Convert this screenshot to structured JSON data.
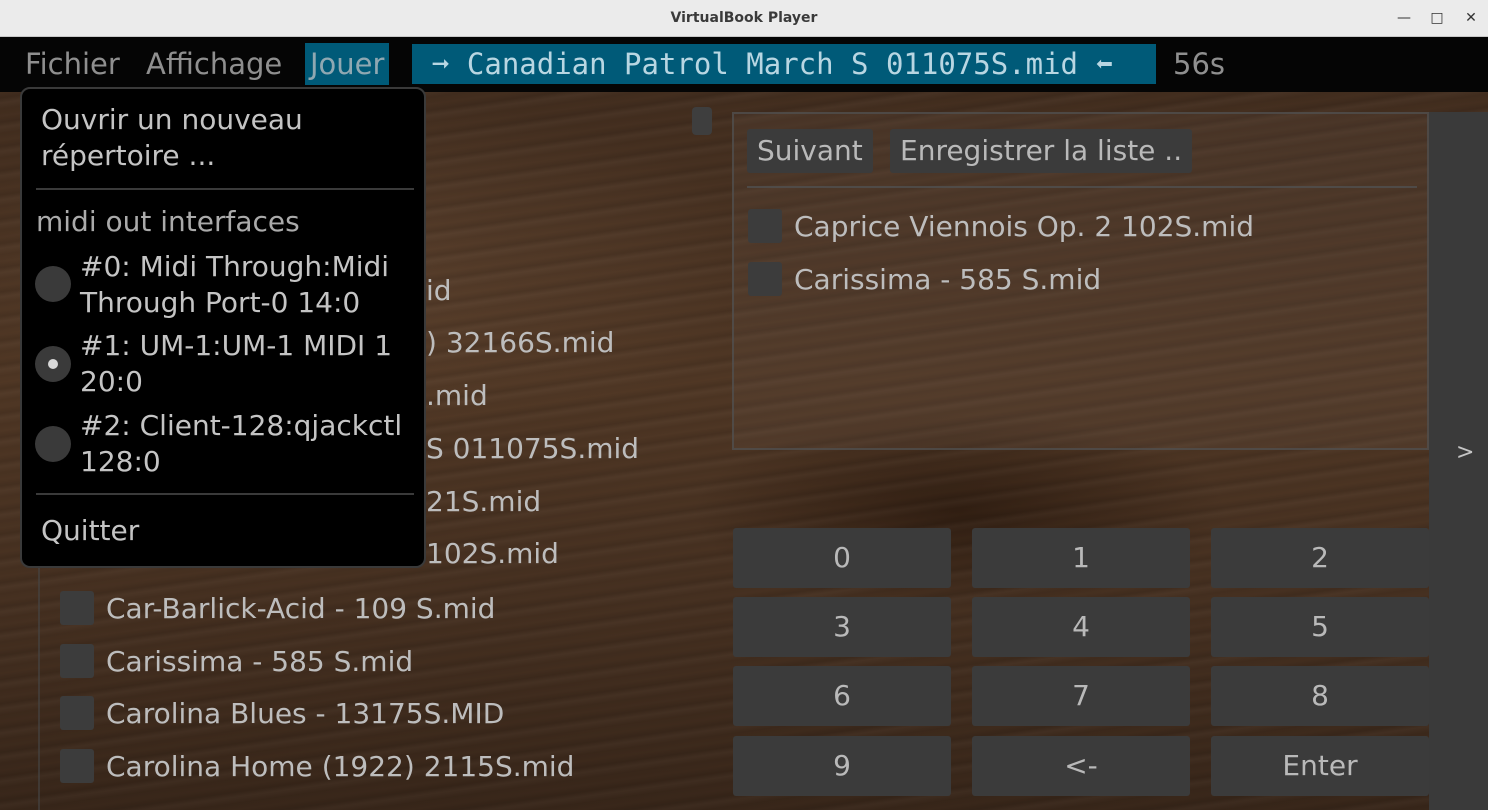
{
  "window": {
    "title": "VirtualBook Player"
  },
  "menubar": {
    "file": "Fichier",
    "view": "Affichage",
    "play": "Jouer",
    "now_playing": "➞ Canadian Patrol March S 011075S.mid ⬅",
    "elapsed": "56s"
  },
  "dropdown": {
    "open_directory": "Ouvrir un nouveau répertoire ...",
    "midi_header": "midi out interfaces",
    "interfaces": [
      {
        "label": "#0: Midi Through:Midi Through Port-0 14:0",
        "selected": false
      },
      {
        "label": "#1: UM-1:UM-1 MIDI 1 20:0",
        "selected": true
      },
      {
        "label": "#2: Client-128:qjackctl 128:0",
        "selected": false
      }
    ],
    "quit": "Quitter"
  },
  "file_list": {
    "partial": [
      "id",
      ") 32166S.mid",
      ".mid",
      "S 011075S.mid",
      "21S.mid",
      "102S.mid"
    ],
    "items": [
      "Car-Barlick-Acid - 109 S.mid",
      "Carissima - 585 S.mid",
      "Carolina Blues - 13175S.MID",
      "Carolina Home (1922) 2115S.mid"
    ]
  },
  "playlist": {
    "next_button": "Suivant",
    "save_button": "Enregistrer la liste ..",
    "items": [
      "Caprice Viennois Op. 2 102S.mid",
      "Carissima - 585 S.mid"
    ]
  },
  "side_toggle": ">",
  "keypad": {
    "keys": [
      "0",
      "1",
      "2",
      "3",
      "4",
      "5",
      "6",
      "7",
      "8",
      "9",
      "<-",
      "Enter"
    ]
  }
}
